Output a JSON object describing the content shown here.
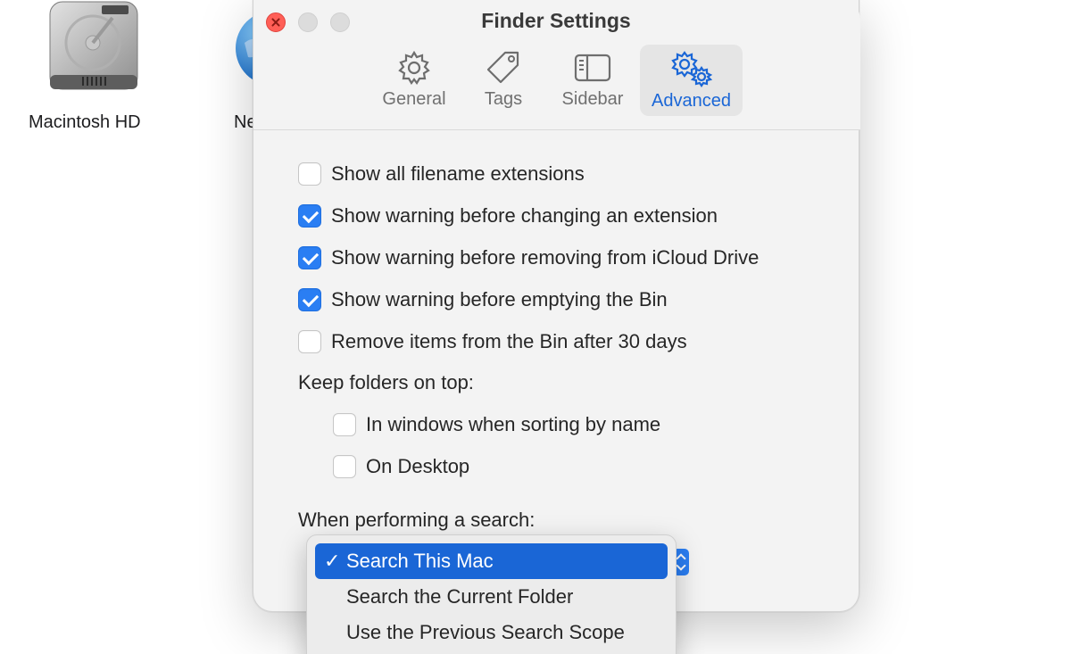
{
  "desktop": {
    "icons": [
      {
        "label": "Macintosh HD"
      },
      {
        "label": "Ne"
      }
    ]
  },
  "window": {
    "title": "Finder Settings",
    "tabs": [
      {
        "label": "General",
        "icon": "gear-icon"
      },
      {
        "label": "Tags",
        "icon": "tag-icon"
      },
      {
        "label": "Sidebar",
        "icon": "sidebar-icon"
      },
      {
        "label": "Advanced",
        "icon": "gears-icon",
        "active": true
      }
    ]
  },
  "settings": {
    "checkboxes": [
      {
        "label": "Show all filename extensions",
        "checked": false
      },
      {
        "label": "Show warning before changing an extension",
        "checked": true
      },
      {
        "label": "Show warning before removing from iCloud Drive",
        "checked": true
      },
      {
        "label": "Show warning before emptying the Bin",
        "checked": true
      },
      {
        "label": "Remove items from the Bin after 30 days",
        "checked": false
      }
    ],
    "keep_folders_label": "Keep folders on top:",
    "keep_folders_options": [
      {
        "label": "In windows when sorting by name",
        "checked": false
      },
      {
        "label": "On Desktop",
        "checked": false
      }
    ],
    "search_label": "When performing a search:",
    "search_menu": {
      "options": [
        {
          "label": "Search This Mac",
          "selected": true,
          "check": "✓"
        },
        {
          "label": "Search the Current Folder",
          "selected": false
        },
        {
          "label": "Use the Previous Search Scope",
          "selected": false
        }
      ]
    }
  },
  "colors": {
    "accent": "#1a66d6",
    "checkbox_checked": "#2a7ef3",
    "close_button": "#ff5f57"
  }
}
